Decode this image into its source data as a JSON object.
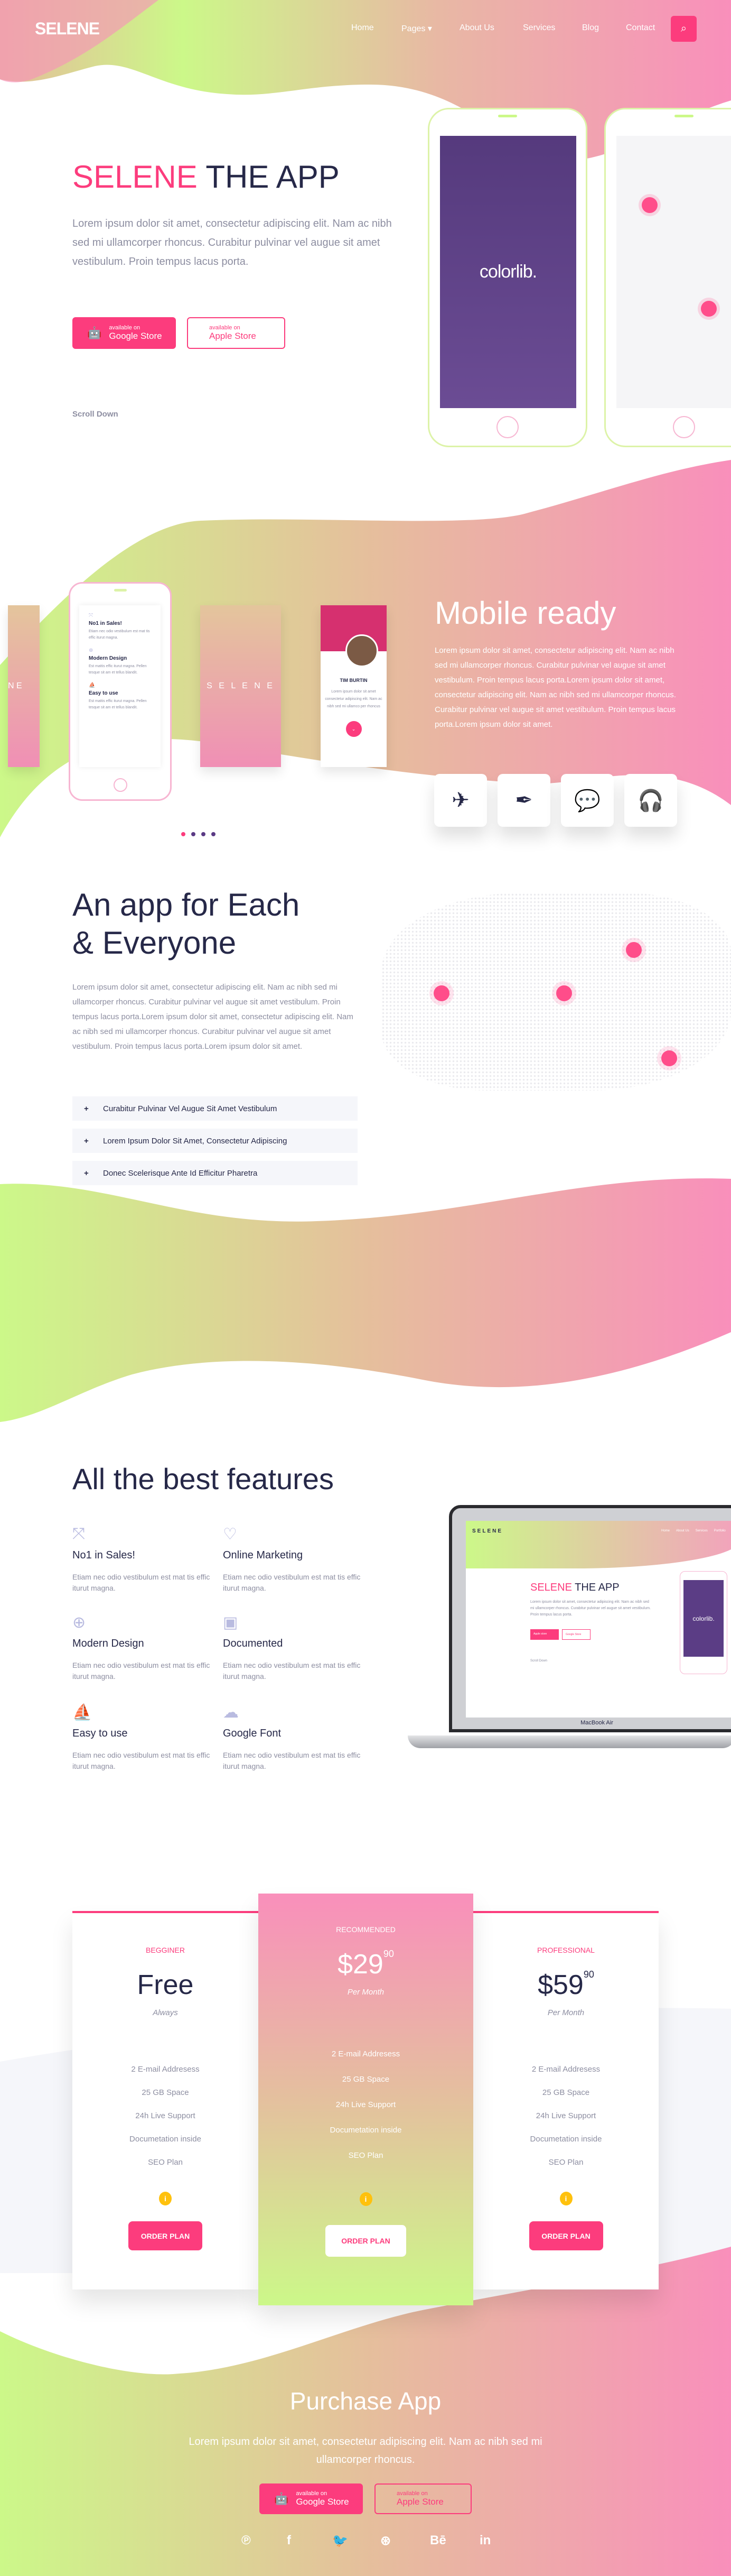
{
  "colors": {
    "accent": "#fc3c7d",
    "lime": "#ccf889",
    "pink": "#f98fbb",
    "navy": "#262848",
    "grey_text": "#8d8ea1"
  },
  "header": {
    "logo": "SELENE",
    "nav": [
      "Home",
      "Pages",
      "About Us",
      "Services",
      "Blog",
      "Contact"
    ],
    "pages_caret": "▾",
    "search_icon": "search-icon"
  },
  "hero": {
    "title_accent": "SELENE",
    "title_rest": "THE APP",
    "text": "Lorem ipsum dolor sit amet, consectetur adipiscing elit. Nam ac nibh sed mi ullamcorper rhoncus. Curabitur pulvinar vel augue sit amet vestibulum. Proin tempus lacus porta.",
    "google": {
      "small": "available on",
      "big": "Google Store"
    },
    "apple": {
      "small": "available on",
      "big": "Apple Store"
    },
    "scroll": "Scroll Down",
    "phone_brand": "colorlib."
  },
  "mobile": {
    "title": "Mobile ready",
    "text": "Lorem ipsum dolor sit amet, consectetur adipiscing elit. Nam ac nibh sed mi ullamcorper rhoncus. Curabitur pulvinar vel augue sit amet vestibulum. Proin tempus lacus porta.Lorem ipsum dolor sit amet, consectetur adipiscing elit. Nam ac nibh sed mi ullamcorper rhoncus. Curabitur pulvinar vel augue sit amet vestibulum. Proin tempus lacus porta.Lorem ipsum dolor sit amet.",
    "screen_features": [
      {
        "title": "No1 in Sales!",
        "text": "Etiam nec odio vestibulum est mat tis effic iturut magna."
      },
      {
        "title": "Modern Design",
        "text": "Est mattis effic iturut magna. Pellen tesque sit am et tellus blandit."
      },
      {
        "title": "Easy to use",
        "text": "Est mattis effic iturut magna. Pellen tesque sit am et tellus blandit."
      }
    ],
    "splash_left": "N E",
    "splash": "S E L E N E",
    "profile_name": "TIM BURTIN",
    "profile_text": "Lorem ipsum dolor sit amet consectetur adipiscing elit. Nam ac nibh sed mi ullamco per rhoncus",
    "icons": [
      "paper-plane-icon",
      "vector-pen-icon",
      "chat-bubble-icon",
      "headphones-icon"
    ]
  },
  "everyone": {
    "title_line1": "An app for Each",
    "title_line2": "& Everyone",
    "text": "Lorem ipsum dolor sit amet, consectetur adipiscing elit. Nam ac nibh sed mi ullamcorper rhoncus. Curabitur pulvinar vel augue sit amet vestibulum. Proin tempus lacus porta.Lorem ipsum dolor sit amet, consectetur adipiscing elit. Nam ac nibh sed mi ullamcorper rhoncus. Curabitur pulvinar vel augue sit amet vestibulum. Proin tempus lacus porta.Lorem ipsum dolor sit amet.",
    "accordion": [
      "Curabitur Pulvinar Vel Augue Sit Amet Vestibulum",
      "Lorem Ipsum Dolor Sit Amet, Consectetur Adipiscing",
      "Donec Scelerisque Ante Id Efficitur Pharetra"
    ],
    "plus": "+"
  },
  "features": {
    "title": "All the best features",
    "items": [
      {
        "icon": "arrows-in-icon",
        "glyph": "⤧",
        "title": "No1 in Sales!",
        "text": "Etiam nec odio vestibulum est mat tis effic iturut magna."
      },
      {
        "icon": "heart-icon",
        "glyph": "♡",
        "title": "Online Marketing",
        "text": "Etiam nec odio vestibulum est mat tis effic iturut magna."
      },
      {
        "icon": "lifebuoy-icon",
        "glyph": "⊕",
        "title": "Modern Design",
        "text": "Etiam nec odio vestibulum est mat tis effic iturut magna."
      },
      {
        "icon": "briefcase-icon",
        "glyph": "▣",
        "title": "Documented",
        "text": "Etiam nec odio vestibulum est mat tis effic iturut magna."
      },
      {
        "icon": "sailboat-icon",
        "glyph": "⛵",
        "title": "Easy to use",
        "text": "Etiam nec odio vestibulum est mat tis effic iturut magna."
      },
      {
        "icon": "cloud-icon",
        "glyph": "☁",
        "title": "Google Font",
        "text": "Etiam nec odio vestibulum est mat tis effic iturut magna."
      }
    ],
    "laptop": {
      "logo": "SELENE",
      "nav": [
        "Home",
        "About Us",
        "Services",
        "Portfolio"
      ],
      "title_accent": "SELENE",
      "title_rest": "THE APP",
      "text": "Lorem ipsum dolor sit amet, consectetur adipiscing elit. Nam ac nibh sed mi ullamcorper rhoncus. Curabitur pulvinar vel augue sit amet vestibulum. Proin tempus lacus porta.",
      "btn1": "Apple store",
      "btn2": "Google Store",
      "scroll": "Scroll Down",
      "brand": "colorlib.",
      "model": "MacBook Air"
    }
  },
  "pricing": {
    "plans": [
      {
        "level": "BEGGINER",
        "price": "Free",
        "cents": "",
        "period": "Always",
        "features": [
          "2 E-mail Addresess",
          "25 GB Space",
          "24h Live Support",
          "Documetation inside",
          "SEO Plan"
        ],
        "button": "ORDER PLAN"
      },
      {
        "level": "RECOMMENDED",
        "price": "$29",
        "cents": "90",
        "period": "Per Month",
        "features": [
          "2 E-mail Addresess",
          "25 GB Space",
          "24h Live Support",
          "Documetation inside",
          "SEO Plan"
        ],
        "button": "ORDER PLAN"
      },
      {
        "level": "PROFESSIONAL",
        "price": "$59",
        "cents": "90",
        "period": "Per Month",
        "features": [
          "2 E-mail Addresess",
          "25 GB Space",
          "24h Live Support",
          "Documetation inside",
          "SEO Plan"
        ],
        "button": "ORDER PLAN"
      }
    ],
    "info": "i"
  },
  "purchase": {
    "title": "Purchase App",
    "text": "Lorem ipsum dolor sit amet, consectetur adipiscing elit. Nam ac nibh sed mi ullamcorper rhoncus.",
    "google": {
      "small": "available on",
      "big": "Google Store"
    },
    "apple": {
      "small": "available on",
      "big": "Apple Store"
    },
    "social": [
      {
        "icon": "pinterest-icon",
        "glyph": "℗"
      },
      {
        "icon": "facebook-icon",
        "glyph": "f"
      },
      {
        "icon": "twitter-icon",
        "glyph": "🐦"
      },
      {
        "icon": "dribbble-icon",
        "glyph": "⊛"
      },
      {
        "icon": "behance-icon",
        "glyph": "Bē"
      },
      {
        "icon": "linkedin-icon",
        "glyph": "in"
      }
    ]
  }
}
